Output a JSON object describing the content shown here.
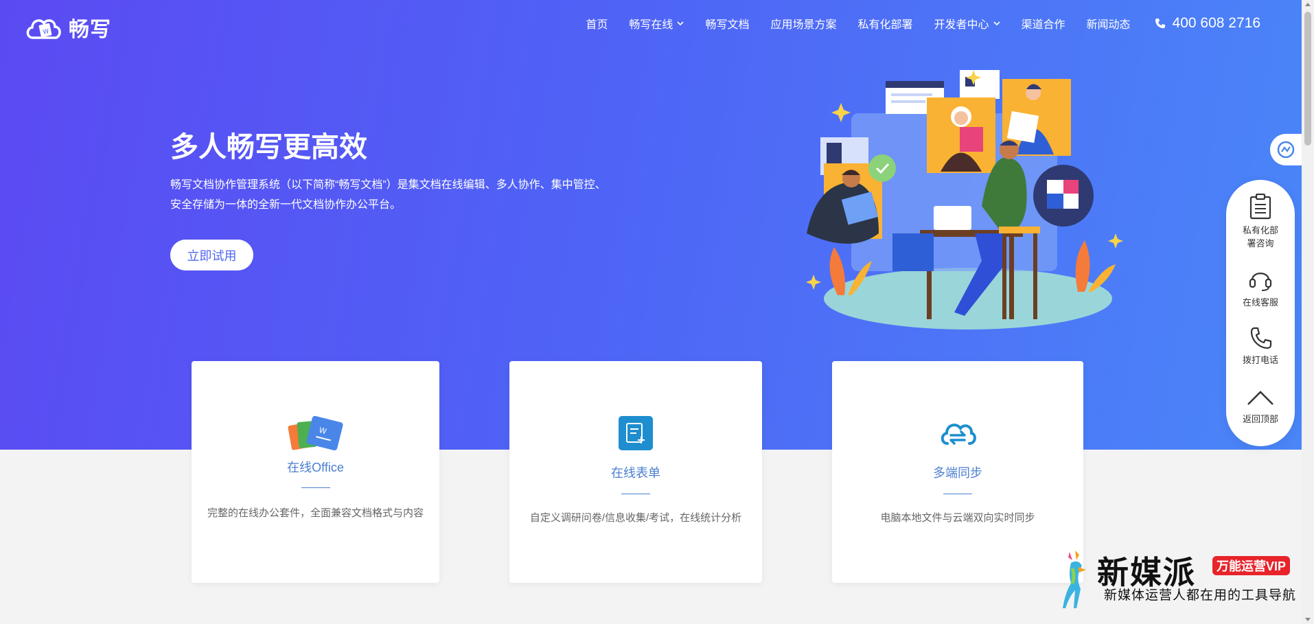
{
  "header": {
    "logo_text": "畅写",
    "nav": [
      {
        "label": "首页",
        "dropdown": false
      },
      {
        "label": "畅写在线",
        "dropdown": true
      },
      {
        "label": "畅写文档",
        "dropdown": false
      },
      {
        "label": "应用场景方案",
        "dropdown": false
      },
      {
        "label": "私有化部署",
        "dropdown": false
      },
      {
        "label": "开发者中心",
        "dropdown": true
      },
      {
        "label": "渠道合作",
        "dropdown": false
      },
      {
        "label": "新闻动态",
        "dropdown": false
      }
    ],
    "phone": "400 608 2716"
  },
  "hero": {
    "title": "多人畅写更高效",
    "description": "畅写文档协作管理系统（以下简称“畅写文档”）是集文档在线编辑、多人协作、集中管控、安全存储为一体的全新一代文档协作办公平台。",
    "button_label": "立即试用"
  },
  "features": [
    {
      "title": "在线Office",
      "description": "完整的在线办公套件，全面兼容文档格式与内容",
      "icon": "office-files-icon"
    },
    {
      "title": "在线表单",
      "description": "自定义调研问卷/信息收集/考试，在线统计分析",
      "icon": "form-icon"
    },
    {
      "title": "多端同步",
      "description": "电脑本地文件与云端双向实时同步",
      "icon": "cloud-sync-icon"
    }
  ],
  "side_panel": {
    "items": [
      {
        "label": "私有化部署咨询",
        "icon": "clipboard-icon"
      },
      {
        "label": "在线客服",
        "icon": "headset-icon"
      },
      {
        "label": "拨打电话",
        "icon": "phone-icon"
      },
      {
        "label": "返回顶部",
        "icon": "chevron-up-icon"
      }
    ]
  },
  "watermark": {
    "brand": "新媒派",
    "badge": "万能运营VIP",
    "subtitle": "新媒体运营人都在用的工具导航"
  },
  "colors": {
    "hero_start": "#5b4af2",
    "hero_end": "#4a86f8",
    "accent_blue": "#4a7fd1",
    "badge_red": "#e8232a"
  }
}
